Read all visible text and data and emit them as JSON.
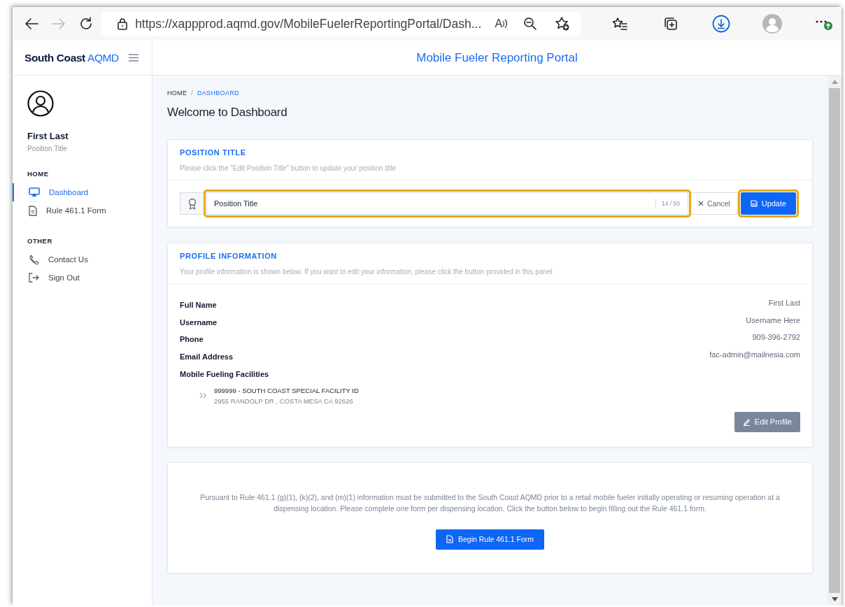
{
  "browser": {
    "url": "https://xappprod.aqmd.gov/MobileFuelerReportingPortal/Dash...",
    "read_aloud": "A",
    "forward_disabled": true
  },
  "sidebar": {
    "brand_bold": "South Coast",
    "brand_light": "AQMD",
    "user": {
      "name": "First Last",
      "title": "Position Title"
    },
    "sections": [
      {
        "heading": "HOME",
        "items": [
          {
            "label": "Dashboard",
            "selected": true
          },
          {
            "label": "Rule 461.1 Form",
            "selected": false
          }
        ]
      },
      {
        "heading": "OTHER",
        "items": [
          {
            "label": "Contact Us",
            "selected": false
          },
          {
            "label": "Sign Out",
            "selected": false
          }
        ]
      }
    ]
  },
  "header": {
    "title": "Mobile Fueler Reporting Portal"
  },
  "breadcrumb_separator": "/",
  "breadcrumb": [
    {
      "label": "HOME",
      "selected": false
    },
    {
      "label": "DASHBOARD",
      "selected": true
    }
  ],
  "page_title": "Welcome to Dashboard",
  "position_card": {
    "title": "POSITION TITLE",
    "subtitle": "Please click the \"Edit Position Title\" button to update your position title",
    "input": {
      "value": "Position Title",
      "counter": "14 / 50",
      "highlighted": true
    },
    "cancel_button": "Cancel",
    "update_button": {
      "label": "Update",
      "highlighted": true
    }
  },
  "profile_card": {
    "title": "PROFILE INFORMATION",
    "subtitle": "Your profile information is shown below. If you want to edit your information, please click the button provided in this panel",
    "fields": [
      {
        "label": "Full Name",
        "value": "First Last"
      },
      {
        "label": "Username",
        "value": "Username Here"
      },
      {
        "label": "Phone",
        "value": "909-396-2792"
      },
      {
        "label": "Email Address",
        "value": "fac-admin@mailnesia.com"
      }
    ],
    "facilities_label": "Mobile Fueling Facilities",
    "facilities": [
      {
        "name": "999999 - SOUTH COAST SPECIAL FACILITY ID",
        "address": "2955 RANDOLP DR , COSTA MESA CA 92626"
      }
    ],
    "edit_button": "Edit Profile"
  },
  "notice_card": {
    "text": "Pursuant to Rule 461.1 (g)(1), (k)(2), and (m)(1) information must be submitted to the South Coast AQMD prior to a retail mobile fueler initially operating or resuming operation at a dispensing location. Please complete one form per dispensing location. Click the button below to begin filling out the Rule 461.1 form.",
    "button": "Begin Rule 461.1 Form"
  }
}
